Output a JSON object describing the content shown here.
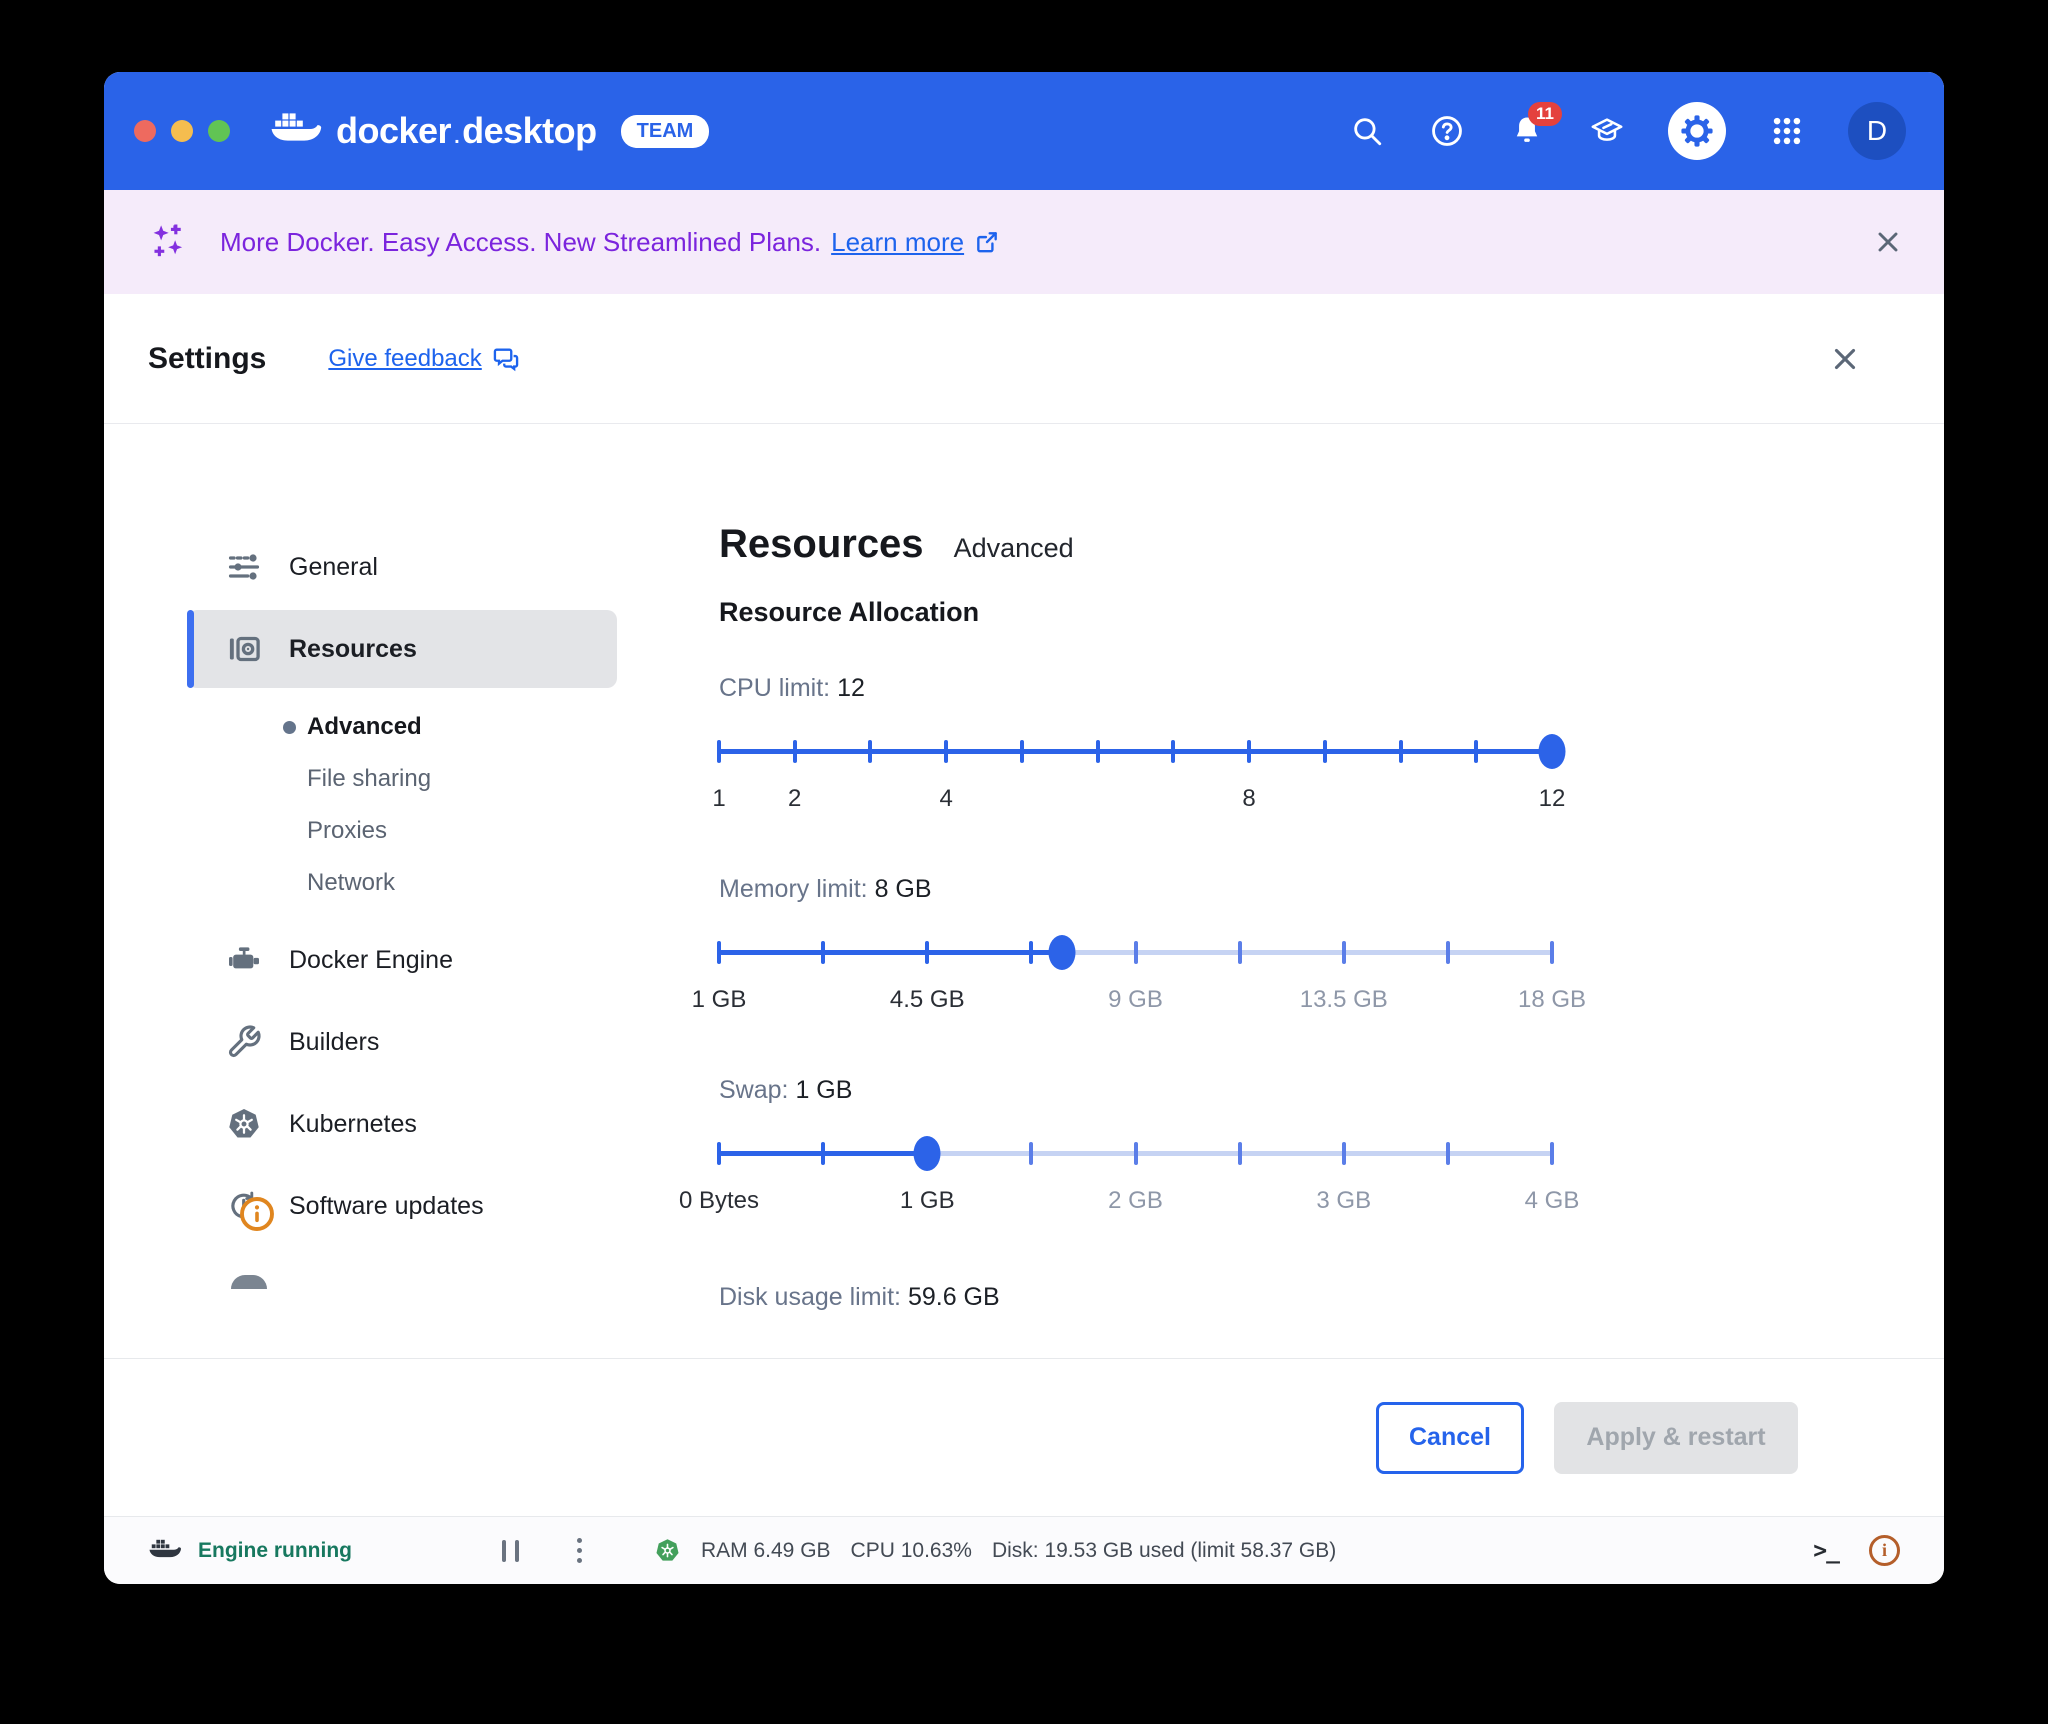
{
  "titlebar": {
    "brand_left": "docker",
    "brand_dot": ".",
    "brand_right": "desktop",
    "badge": "TEAM",
    "notification_count": "11",
    "avatar_initial": "D",
    "colors": {
      "bar": "#2a63e8",
      "avatar_bg": "#1d4fc0",
      "badge_red": "#e4413d"
    }
  },
  "banner": {
    "message": "More Docker. Easy Access. New Streamlined Plans.",
    "link_label": "Learn more",
    "colors": {
      "background": "#f5ebfa",
      "text": "#7b24dd",
      "link": "#1d63ed"
    }
  },
  "settings_header": {
    "title": "Settings",
    "feedback_link": "Give feedback"
  },
  "sidebar": {
    "items": [
      {
        "label": "General"
      },
      {
        "label": "Resources",
        "selected": true
      },
      {
        "label": "Docker Engine"
      },
      {
        "label": "Builders"
      },
      {
        "label": "Kubernetes"
      },
      {
        "label": "Software updates"
      }
    ],
    "resources_children": [
      {
        "label": "Advanced",
        "active": true
      },
      {
        "label": "File sharing"
      },
      {
        "label": "Proxies"
      },
      {
        "label": "Network"
      }
    ]
  },
  "content": {
    "title": "Resources",
    "subtitle": "Advanced",
    "section_heading": "Resource Allocation",
    "sliders": [
      {
        "label": "CPU limit:",
        "value": "12",
        "percent": 100,
        "ticks": [
          0,
          9.09,
          18.18,
          27.27,
          36.36,
          45.45,
          54.55,
          63.64,
          72.73,
          81.82,
          90.91,
          100
        ],
        "labels": [
          {
            "text": "1",
            "pos": 0,
            "passed": true
          },
          {
            "text": "2",
            "pos": 9.09,
            "passed": true
          },
          {
            "text": "4",
            "pos": 27.27,
            "passed": true
          },
          {
            "text": "8",
            "pos": 63.64,
            "passed": true
          },
          {
            "text": "12",
            "pos": 100,
            "passed": true
          }
        ]
      },
      {
        "label": "Memory limit:",
        "value": "8 GB",
        "percent": 41.2,
        "ticks": [
          0,
          12.5,
          25,
          37.5,
          50,
          62.5,
          75,
          87.5,
          100
        ],
        "labels": [
          {
            "text": "1 GB",
            "pos": 0,
            "passed": true
          },
          {
            "text": "4.5 GB",
            "pos": 25,
            "passed": true
          },
          {
            "text": "9 GB",
            "pos": 50,
            "passed": false
          },
          {
            "text": "13.5 GB",
            "pos": 75,
            "passed": false
          },
          {
            "text": "18 GB",
            "pos": 100,
            "passed": false
          }
        ]
      },
      {
        "label": "Swap:",
        "value": "1 GB",
        "percent": 25,
        "ticks": [
          0,
          12.5,
          25,
          37.5,
          50,
          62.5,
          75,
          87.5,
          100
        ],
        "labels": [
          {
            "text": "0 Bytes",
            "pos": 0,
            "passed": true
          },
          {
            "text": "1 GB",
            "pos": 25,
            "passed": true
          },
          {
            "text": "2 GB",
            "pos": 50,
            "passed": false
          },
          {
            "text": "3 GB",
            "pos": 75,
            "passed": false
          },
          {
            "text": "4 GB",
            "pos": 100,
            "passed": false
          }
        ]
      }
    ],
    "disk_label": "Disk usage limit:",
    "disk_value": "59.6 GB",
    "colors": {
      "slider_fill": "#2c63e8",
      "slider_rest": "#c6d3f3"
    }
  },
  "footer": {
    "cancel_label": "Cancel",
    "apply_label": "Apply & restart"
  },
  "statusbar": {
    "engine_status": "Engine running",
    "ram": "RAM 6.49 GB",
    "cpu": "CPU 10.63%",
    "disk": "Disk: 19.53 GB used (limit 58.37 GB)",
    "colors": {
      "engine_text": "#17785f",
      "info_icon": "#b45e2a"
    }
  }
}
